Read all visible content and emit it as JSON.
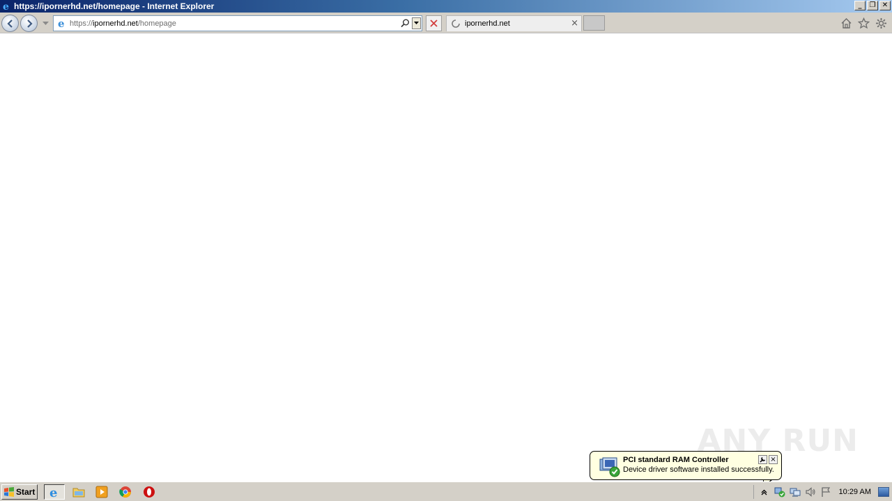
{
  "window": {
    "title": "https://ipornerhd.net/homepage - Internet Explorer",
    "controls": {
      "minimize": "_",
      "restore": "❐",
      "close": "✕"
    }
  },
  "navbar": {
    "address": {
      "scheme": "https://",
      "host": "ipornerhd.net",
      "path": "/homepage"
    },
    "tab": {
      "title": "ipornerhd.net",
      "close": "×"
    }
  },
  "watermark": "ANY RUN",
  "notification": {
    "title": "PCI standard RAM Controller",
    "message": "Device driver software installed successfully.",
    "close": "×"
  },
  "taskbar": {
    "start_label": "Start",
    "apps": [
      "internet-explorer",
      "windows-explorer",
      "media-player",
      "chrome",
      "opera"
    ],
    "clock": "10:29 AM"
  }
}
